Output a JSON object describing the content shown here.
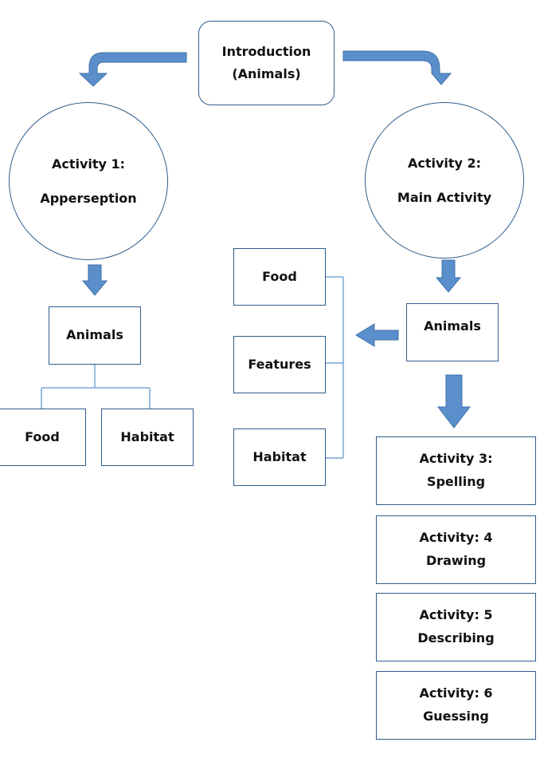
{
  "colors": {
    "arrow_fill": "#5b8fcc",
    "arrow_stroke": "#3f70a8",
    "node_border": "#2f5d8a",
    "connector_line": "#7aa6d6"
  },
  "intro": {
    "line1": "Introduction",
    "line2": "(Animals)"
  },
  "activity1": {
    "line1": "Activity 1:",
    "line2": "Apperseption"
  },
  "activity2": {
    "line1": "Activity 2:",
    "line2": "Main Activity"
  },
  "left_branch": {
    "root": "Animals",
    "children": [
      "Food",
      "Habitat"
    ]
  },
  "right_branch": {
    "root": "Animals",
    "children": [
      "Food",
      "Features",
      "Habitat"
    ]
  },
  "activities": [
    {
      "line1": "Activity 3:",
      "line2": "Spelling"
    },
    {
      "line1": "Activity: 4",
      "line2": "Drawing"
    },
    {
      "line1": "Activity: 5",
      "line2": "Describing"
    },
    {
      "line1": "Activity: 6",
      "line2": "Guessing"
    }
  ]
}
